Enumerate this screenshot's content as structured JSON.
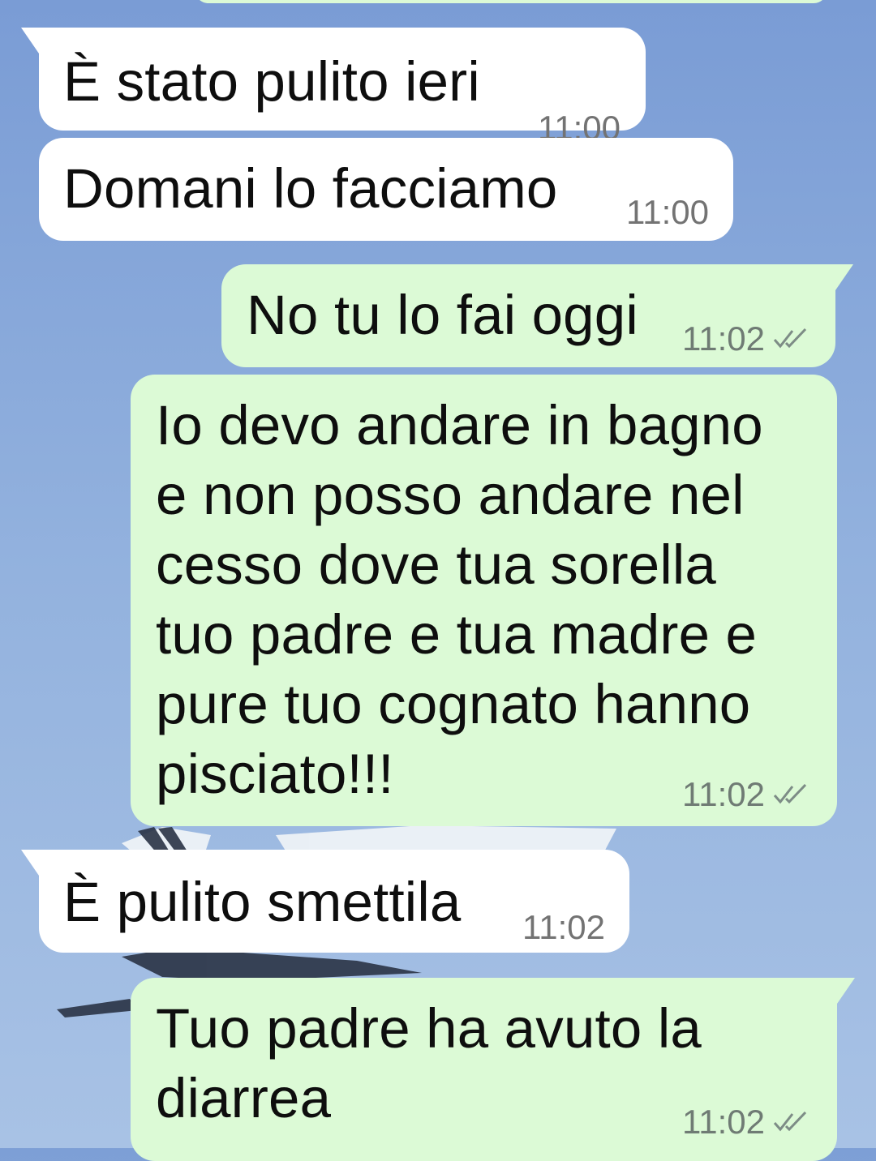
{
  "chat": {
    "messages": [
      {
        "direction": "incoming",
        "text": "È stato pulito ieri",
        "time": "11:00"
      },
      {
        "direction": "incoming",
        "text": "Domani lo facciamo",
        "time": "11:00"
      },
      {
        "direction": "outgoing",
        "text": "No tu lo fai oggi",
        "time": "11:02",
        "status_icon": "double-check-icon"
      },
      {
        "direction": "outgoing",
        "lines": [
          "Io devo andare in bagno",
          "e non posso andare nel",
          "cesso dove tua sorella",
          "tuo padre e tua madre e",
          "pure tuo cognato hanno",
          "pisciato!!!"
        ],
        "time": "11:02",
        "status_icon": "double-check-icon"
      },
      {
        "direction": "incoming",
        "text": "È pulito smettila",
        "time": "11:02"
      },
      {
        "direction": "outgoing",
        "lines": [
          "Tuo padre ha avuto la",
          "diarrea"
        ],
        "time": "11:02",
        "status_icon": "double-check-icon"
      }
    ]
  },
  "colors": {
    "incoming_bubble": "#ffffff",
    "outgoing_bubble": "#dcfad6",
    "background": "#8eaedc",
    "timestamp": "#6f7b74",
    "read_ticks": "#7d8c86"
  }
}
